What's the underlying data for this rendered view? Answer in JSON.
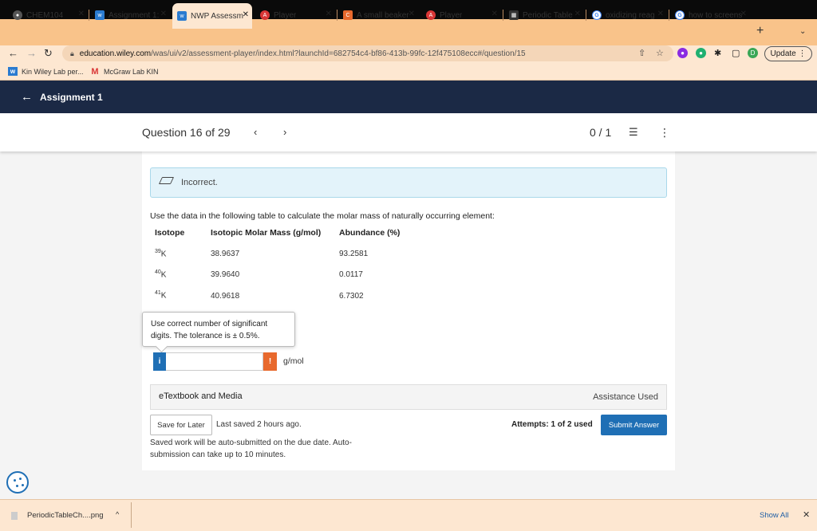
{
  "browser": {
    "tabs": [
      {
        "label": "CHEM104",
        "icon": "circle-icon",
        "color": "#555555"
      },
      {
        "label": "Assignment 1:",
        "icon": "wiley-icon",
        "color": "#2a7bd0"
      },
      {
        "label": "NWP Assessm",
        "icon": "wiley-icon",
        "color": "#2a7bd0"
      },
      {
        "label": "Player",
        "icon": "player-icon",
        "color": "#d93636"
      },
      {
        "label": "A small beaker",
        "icon": "chegg-icon",
        "color": "#e8692d"
      },
      {
        "label": "Player",
        "icon": "player-icon",
        "color": "#d93636"
      },
      {
        "label": "Periodic Table",
        "icon": "periodic-table-icon",
        "color": "#333333"
      },
      {
        "label": "oxidizing reag",
        "icon": "google-icon",
        "color": "#4285f4"
      },
      {
        "label": "how to screens",
        "icon": "google-icon",
        "color": "#4285f4"
      }
    ],
    "url_host": "education.wiley.com",
    "url_path": "/was/ui/v2/assessment-player/index.html?launchId=682754c4-bf86-413b-99fc-12f475108ecc#/question/15",
    "update_label": "Update",
    "profile_initial": "D",
    "bookmarks": [
      {
        "label": "Kin Wiley Lab per...",
        "icon": "wiley-icon"
      },
      {
        "label": "McGraw Lab KIN",
        "icon": "mcgraw-icon"
      }
    ]
  },
  "header": {
    "title": "Assignment 1"
  },
  "question_bar": {
    "title": "Question 16 of 29",
    "score": "0 / 1"
  },
  "feedback": {
    "status": "Incorrect."
  },
  "question": {
    "prompt": "Use the data in the following table to calculate the molar mass of naturally occurring element:",
    "table": {
      "headers": [
        "Isotope",
        "Isotopic Molar Mass (g/mol)",
        "Abundance (%)"
      ],
      "rows": [
        {
          "mass_number": "39",
          "symbol": "K",
          "molar_mass": "38.9637",
          "abundance": "93.2581"
        },
        {
          "mass_number": "40",
          "symbol": "K",
          "molar_mass": "39.9640",
          "abundance": "0.0117"
        },
        {
          "mass_number": "41",
          "symbol": "K",
          "molar_mass": "40.9618",
          "abundance": "6.7302"
        }
      ]
    },
    "tooltip": "Use correct number of significant digits. The tolerance is ± 0.5%.",
    "answer_value": "",
    "unit": "g/mol"
  },
  "etextbook": {
    "label": "eTextbook and Media",
    "assistance": "Assistance Used"
  },
  "footer": {
    "save_label": "Save for Later",
    "last_saved": "Last saved 2 hours ago.",
    "attempts": "Attempts: 1 of 2 used",
    "submit_label": "Submit Answer",
    "autosubmit_note": "Saved work will be auto-submitted on the due date. Auto-submission can take up to 10 minutes."
  },
  "downloads": {
    "file": "PeriodicTableCh....png",
    "show_all": "Show All"
  }
}
